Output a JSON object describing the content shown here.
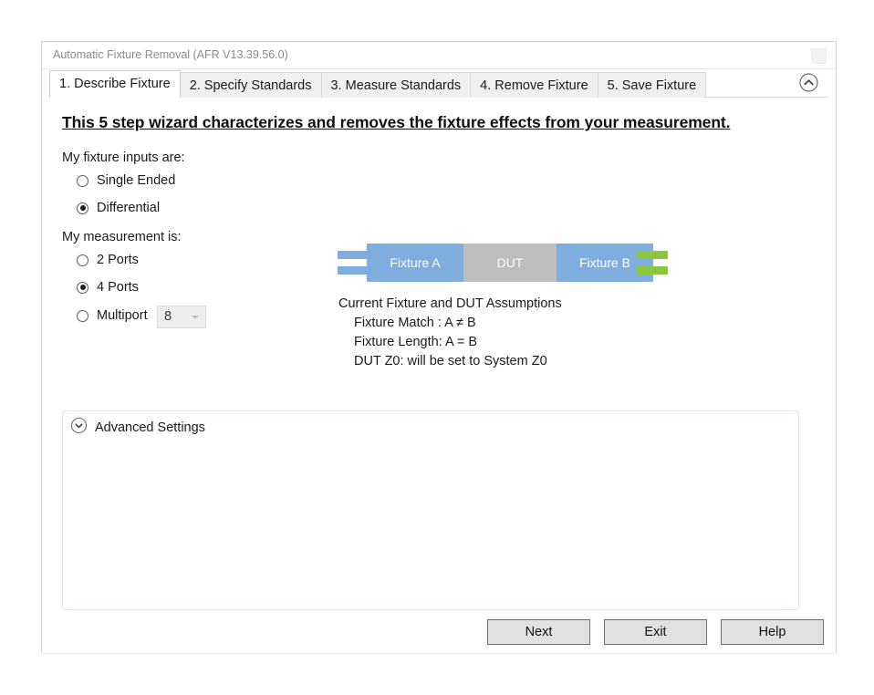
{
  "window": {
    "title": "Automatic Fixture Removal (AFR V13.39.56.0)",
    "titlebar_button_name": "window-box-button"
  },
  "tabs": [
    {
      "label": "1. Describe Fixture",
      "active": true
    },
    {
      "label": "2. Specify Standards",
      "active": false
    },
    {
      "label": "3. Measure Standards",
      "active": false
    },
    {
      "label": "4. Remove Fixture",
      "active": false
    },
    {
      "label": "5. Save Fixture",
      "active": false
    }
  ],
  "collapse_icon": "chevron-up-icon",
  "content": {
    "headline": "This 5 step wizard characterizes and removes the fixture effects from your measurement.",
    "fixture_inputs": {
      "label": "My fixture inputs are:",
      "options": [
        {
          "label": "Single Ended",
          "checked": false
        },
        {
          "label": "Differential",
          "checked": true
        }
      ]
    },
    "measurement": {
      "label": "My measurement is:",
      "options": [
        {
          "label": "2 Ports",
          "checked": false
        },
        {
          "label": "4 Ports",
          "checked": true
        },
        {
          "label": "Multiport",
          "checked": false
        }
      ],
      "multiport_value": "8"
    },
    "diagram": {
      "fixture_a": "Fixture A",
      "dut": "DUT",
      "fixture_b": "Fixture B",
      "colors": {
        "fixture": "#7FAEDE",
        "dut": "#BDBDBD",
        "connector_left": "#7FAEDE",
        "connector_right": "#8CC63F"
      }
    },
    "assumptions": {
      "title": "Current Fixture and DUT Assumptions",
      "lines": [
        "Fixture Match : A ≠ B",
        "Fixture Length: A = B",
        "DUT Z0: will be set to System Z0"
      ]
    },
    "advanced_settings": {
      "label": "Advanced Settings",
      "icon": "chevron-down-circle-icon",
      "expanded": false
    }
  },
  "buttons": {
    "next": "Next",
    "exit": "Exit",
    "help": "Help"
  }
}
